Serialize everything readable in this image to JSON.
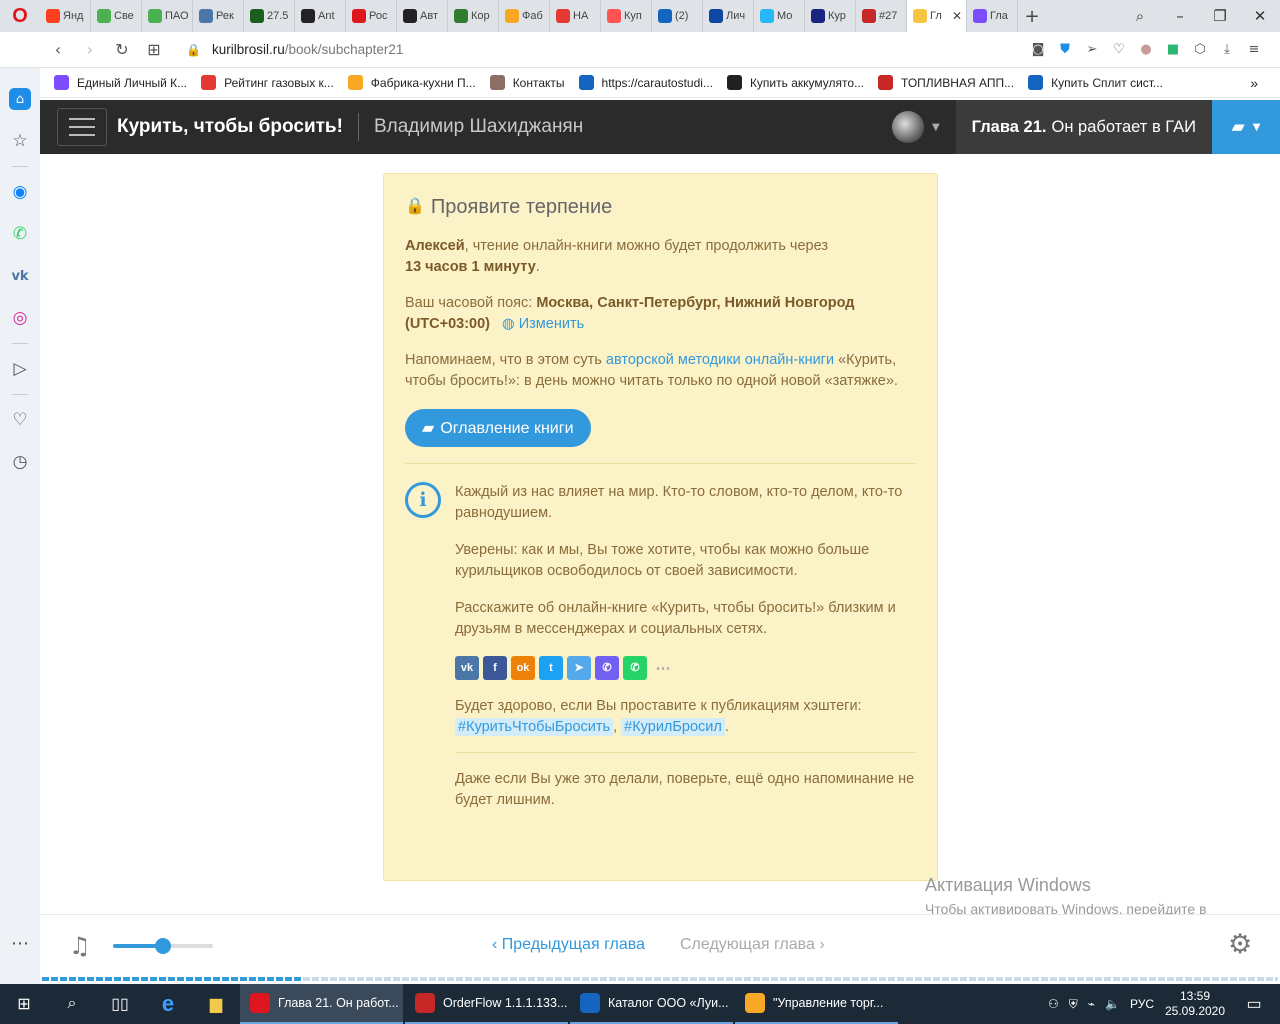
{
  "browser": {
    "tabs": [
      {
        "label": "Янд",
        "color": "#fc3f1d"
      },
      {
        "label": "Све",
        "color": "#4caf50"
      },
      {
        "label": "ПАО",
        "color": "#4caf50"
      },
      {
        "label": "Рек",
        "color": "#4a76a8"
      },
      {
        "label": "27.5",
        "color": "#1b5e20"
      },
      {
        "label": "Ant",
        "color": "#222222"
      },
      {
        "label": "Рос",
        "color": "#e0161f"
      },
      {
        "label": "Авт",
        "color": "#222222"
      },
      {
        "label": "Кор",
        "color": "#2e7d32"
      },
      {
        "label": "Фаб",
        "color": "#f9a825"
      },
      {
        "label": "НА",
        "color": "#e53935"
      },
      {
        "label": "Куп",
        "color": "#ff5252"
      },
      {
        "label": "(2)",
        "color": "#1565c0"
      },
      {
        "label": "Лич",
        "color": "#0d47a1"
      },
      {
        "label": "Мо",
        "color": "#29b6f6"
      },
      {
        "label": "Кур",
        "color": "#1a237e"
      },
      {
        "label": "#27",
        "color": "#c62828"
      },
      {
        "label": "Гл",
        "color": "#f5c542",
        "active": true
      },
      {
        "label": "Гла",
        "color": "#7c4dff"
      }
    ],
    "url": {
      "host": "kurilbrosil.ru",
      "path": "/book/subchapter21"
    },
    "bookmarks": [
      {
        "label": "Единый Личный К...",
        "color": "#7c4dff"
      },
      {
        "label": "Рейтинг газовых к...",
        "color": "#e53935"
      },
      {
        "label": "Фабрика-кухни П...",
        "color": "#f9a825"
      },
      {
        "label": "Контакты",
        "color": "#8d6e63"
      },
      {
        "label": "https://carautostudi...",
        "color": "#1565c0"
      },
      {
        "label": "Купить аккумулято...",
        "color": "#212121"
      },
      {
        "label": "ТОПЛИВНАЯ АПП...",
        "color": "#c62828"
      },
      {
        "label": "Купить Сплит сист...",
        "color": "#1565c0"
      }
    ]
  },
  "site": {
    "book_title": "Курить, чтобы бросить!",
    "author": "Владимир Шахиджанян",
    "chapter_num": "Глава 21.",
    "chapter_name": "Он работает в ГАИ"
  },
  "card": {
    "title": "Проявите терпение",
    "user": "Алексей",
    "wait_text": ", чтение онлайн-книги можно будет продолжить через",
    "wait_time": "13 часов 1 минуту",
    "wait_end": ".",
    "tz_label": "Ваш часовой пояс:",
    "tz_value": "Москва, Санкт-Петербург, Нижний Новгород (UTC+03:00)",
    "tz_change": "Изменить",
    "remind_pre": "Напоминаем, что в этом суть",
    "remind_link": "авторской методики онлайн-книги",
    "remind_post": "«Курить, чтобы бросить!»: в день можно читать только по одной новой «затяжке».",
    "toc_button": "Оглавление книги",
    "info_p1": "Каждый из нас влияет на мир. Кто-то словом, кто-то делом, кто-то равнодушием.",
    "info_p2": "Уверены: как и мы, Вы тоже хотите, чтобы как можно больше курильщиков освободилось от своей зависимости.",
    "info_p3": "Расскажите об онлайн-книге «Курить, чтобы бросить!» близким и друзьям в мессенджерах и социальных сетях.",
    "hashtag_text": "Будет здорово, если Вы проставите к публикациям хэштеги:",
    "hashtag1": "#КуритьЧтобыБросить",
    "hashtag_sep": ",",
    "hashtag2": "#КурилБросил",
    "hashtag_end": ".",
    "final_text": "Даже если Вы уже это делали, поверьте, ещё одно напоминание не будет лишним."
  },
  "social": [
    {
      "name": "vk",
      "glyph": "vk",
      "color": "#4a76a8"
    },
    {
      "name": "facebook",
      "glyph": "f",
      "color": "#3b5998"
    },
    {
      "name": "odnoklassniki",
      "glyph": "ok",
      "color": "#ee8208"
    },
    {
      "name": "twitter",
      "glyph": "t",
      "color": "#1da1f2"
    },
    {
      "name": "telegram",
      "glyph": "➤",
      "color": "#54a9eb"
    },
    {
      "name": "viber",
      "glyph": "✆",
      "color": "#7360f2"
    },
    {
      "name": "whatsapp",
      "glyph": "✆",
      "color": "#25d366"
    }
  ],
  "player": {
    "prev": "‹ Предыдущая глава",
    "next": "Следующая глава ›",
    "volume_fraction": 0.5,
    "reading_progress": 0.21
  },
  "activation": {
    "title": "Активация Windows",
    "text": "Чтобы активировать Windows, перейдите в раздел \"Параметры\"."
  },
  "taskbar": {
    "apps": [
      {
        "label": "Глава 21. Он работ...",
        "color": "#e0161f",
        "active": true
      },
      {
        "label": "OrderFlow 1.1.1.133...",
        "color": "#c62828"
      },
      {
        "label": "Каталог ООО «Луи...",
        "color": "#1565c0"
      },
      {
        "label": "\"Управление торг...",
        "color": "#f9a825"
      }
    ],
    "lang": "РУС",
    "time": "13:59",
    "date": "25.09.2020"
  }
}
